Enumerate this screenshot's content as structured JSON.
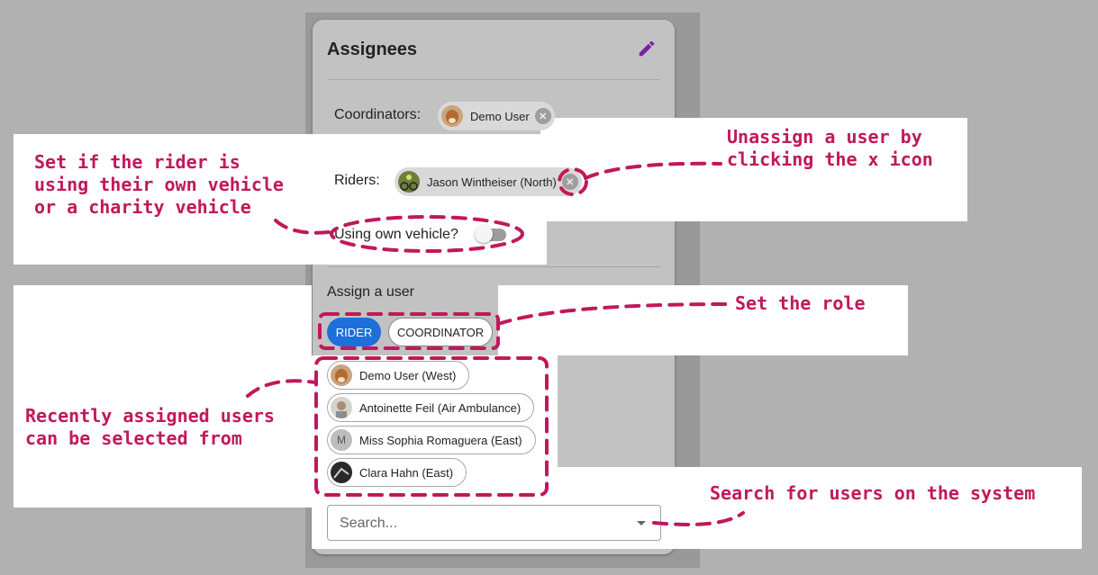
{
  "card": {
    "title": "Assignees",
    "edit_icon": "pencil-icon"
  },
  "coordinators": {
    "label": "Coordinators:",
    "chips": [
      {
        "name": "Demo User",
        "avatar": "dog-photo"
      }
    ]
  },
  "riders": {
    "label": "Riders:",
    "chips": [
      {
        "name": "Jason Wintheiser (North)",
        "avatar": "bike-photo"
      }
    ]
  },
  "own_vehicle": {
    "label": "Using own vehicle?",
    "value": false
  },
  "assign": {
    "heading": "Assign a user",
    "roles": [
      "RIDER",
      "COORDINATOR"
    ],
    "selected_role": "RIDER",
    "recent_users": [
      {
        "name": "Demo User (West)",
        "avatar": "dog-photo"
      },
      {
        "name": "Antoinette Feil (Air Ambulance)",
        "avatar": "person-photo"
      },
      {
        "name": "Miss Sophia Romaguera (East)",
        "avatar_letter": "M"
      },
      {
        "name": "Clara Hahn (East)",
        "avatar": "dark-photo"
      }
    ]
  },
  "search": {
    "placeholder": "Search..."
  },
  "annotations": {
    "vehicle": "Set if the rider is\nusing their own vehicle\nor a charity vehicle",
    "unassign": "Unassign a user by\nclicking the x icon",
    "role": "Set the role",
    "recent": "Recently assigned users\ncan be selected from",
    "search": "Search for users on the system"
  },
  "colors": {
    "accent": "#1d6fd9",
    "annotation": "#c2185b",
    "edit_icon": "#7b1fa2"
  }
}
